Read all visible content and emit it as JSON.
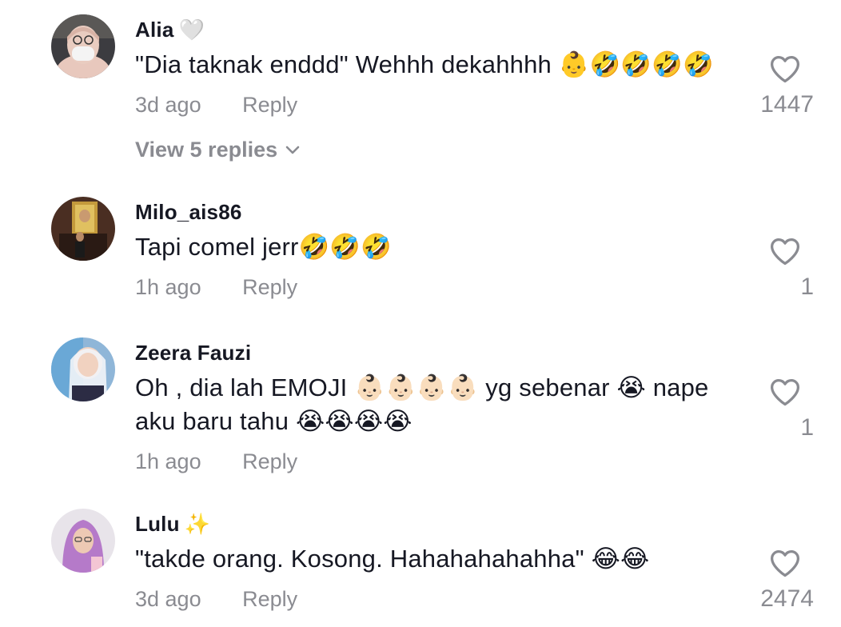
{
  "comments": [
    {
      "username": "Alia",
      "badge": "🤍",
      "text_lines": [
        "\"Dia taknak enddd\" Wehhh dekahhhh 👶🤣🤣🤣🤣"
      ],
      "time": "3d ago",
      "reply_label": "Reply",
      "likes": "1447",
      "view_replies": "View 5 replies"
    },
    {
      "username": "Milo_ais86",
      "badge": "",
      "text_lines": [
        "Tapi comel jerr🤣🤣🤣"
      ],
      "time": "1h ago",
      "reply_label": "Reply",
      "likes": "1"
    },
    {
      "username": "Zeera Fauzi",
      "badge": "",
      "text_lines": [
        "Oh , dia lah EMOJI 👶🏻👶🏻👶🏻👶🏻 yg sebenar 😭 nape",
        "aku baru tahu 😭😭😭😭"
      ],
      "time": "1h ago",
      "reply_label": "Reply",
      "likes": "1"
    },
    {
      "username": "Lulu",
      "badge": "✨",
      "text_lines": [
        "\"takde orang. Kosong. Hahahahahahha\" 😂😂"
      ],
      "time": "3d ago",
      "reply_label": "Reply",
      "likes": "2474"
    }
  ],
  "icons": {
    "like": "heart-outline-icon",
    "expand": "chevron-down-icon"
  },
  "colors": {
    "primary_text": "#161823",
    "secondary_text": "#8a8b91"
  }
}
